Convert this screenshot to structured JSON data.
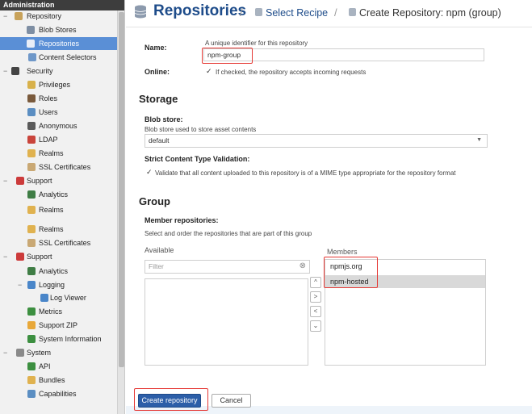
{
  "sidebar": {
    "header": "Administration",
    "items": [
      {
        "label": "Repository",
        "icon": "folder-icon"
      },
      {
        "label": "Blob Stores",
        "icon": "database-icon"
      },
      {
        "label": "Repositories",
        "icon": "database-icon",
        "selected": true
      },
      {
        "label": "Content Selectors",
        "icon": "selector-icon"
      },
      {
        "label": "Security",
        "icon": "security-icon"
      },
      {
        "label": "Privileges",
        "icon": "privileges-icon"
      },
      {
        "label": "Roles",
        "icon": "role-icon"
      },
      {
        "label": "Users",
        "icon": "users-icon"
      },
      {
        "label": "Anonymous",
        "icon": "anonymous-icon"
      },
      {
        "label": "LDAP",
        "icon": "ldap-icon"
      },
      {
        "label": "Realms",
        "icon": "realms-icon"
      },
      {
        "label": "SSL Certificates",
        "icon": "certificate-icon"
      },
      {
        "label": "Support",
        "icon": "support-icon"
      },
      {
        "label": "Analytics",
        "icon": "analytics-icon"
      },
      {
        "label": "Realms",
        "icon": "realms-icon"
      },
      {
        "label": "Realms",
        "icon": "realms-icon"
      },
      {
        "label": "SSL Certificates",
        "icon": "certificate-icon"
      },
      {
        "label": "Support",
        "icon": "support-icon"
      },
      {
        "label": "Analytics",
        "icon": "analytics-icon"
      },
      {
        "label": "Logging",
        "icon": "logging-icon"
      },
      {
        "label": "Log Viewer",
        "icon": "log-viewer-icon"
      },
      {
        "label": "Metrics",
        "icon": "metrics-icon"
      },
      {
        "label": "Support ZIP",
        "icon": "zip-icon"
      },
      {
        "label": "System Information",
        "icon": "system-info-icon"
      },
      {
        "label": "System",
        "icon": "system-icon"
      },
      {
        "label": "API",
        "icon": "api-icon"
      },
      {
        "label": "Bundles",
        "icon": "bundles-icon"
      },
      {
        "label": "Capabilities",
        "icon": "capabilities-icon"
      }
    ]
  },
  "header": {
    "title": "Repositories",
    "sep1": "/",
    "crumb1": "Select Recipe",
    "sep2": "/",
    "crumb2": "Create Repository: npm (group)"
  },
  "form": {
    "name_label": "Name:",
    "name_help": "A unique identifier for this repository",
    "name_value": "npm-group",
    "online_label": "Online:",
    "online_checked": true,
    "online_help": "If checked, the repository accepts incoming requests"
  },
  "storage": {
    "title": "Storage",
    "blob_label": "Blob store:",
    "blob_help": "Blob store used to store asset contents",
    "blob_value": "default",
    "strict_label": "Strict Content Type Validation:",
    "strict_checked": true,
    "strict_help": "Validate that all content uploaded to this repository is of a MIME type appropriate for the repository format"
  },
  "group": {
    "title": "Group",
    "members_label": "Member repositories:",
    "members_help": "Select and order the repositories that are part of this group",
    "available_label": "Available",
    "filter_placeholder": "Filter",
    "members_title": "Members",
    "members": [
      "npmjs.org",
      "npm-hosted"
    ],
    "selected_member": "npm-hosted"
  },
  "buttons": {
    "create": "Create repository",
    "cancel": "Cancel"
  },
  "colors": {
    "accent": "#1e4c8a",
    "selection": "#5a8fd6",
    "highlight_box": "#e53935",
    "primary_button": "#2c5ea8"
  }
}
